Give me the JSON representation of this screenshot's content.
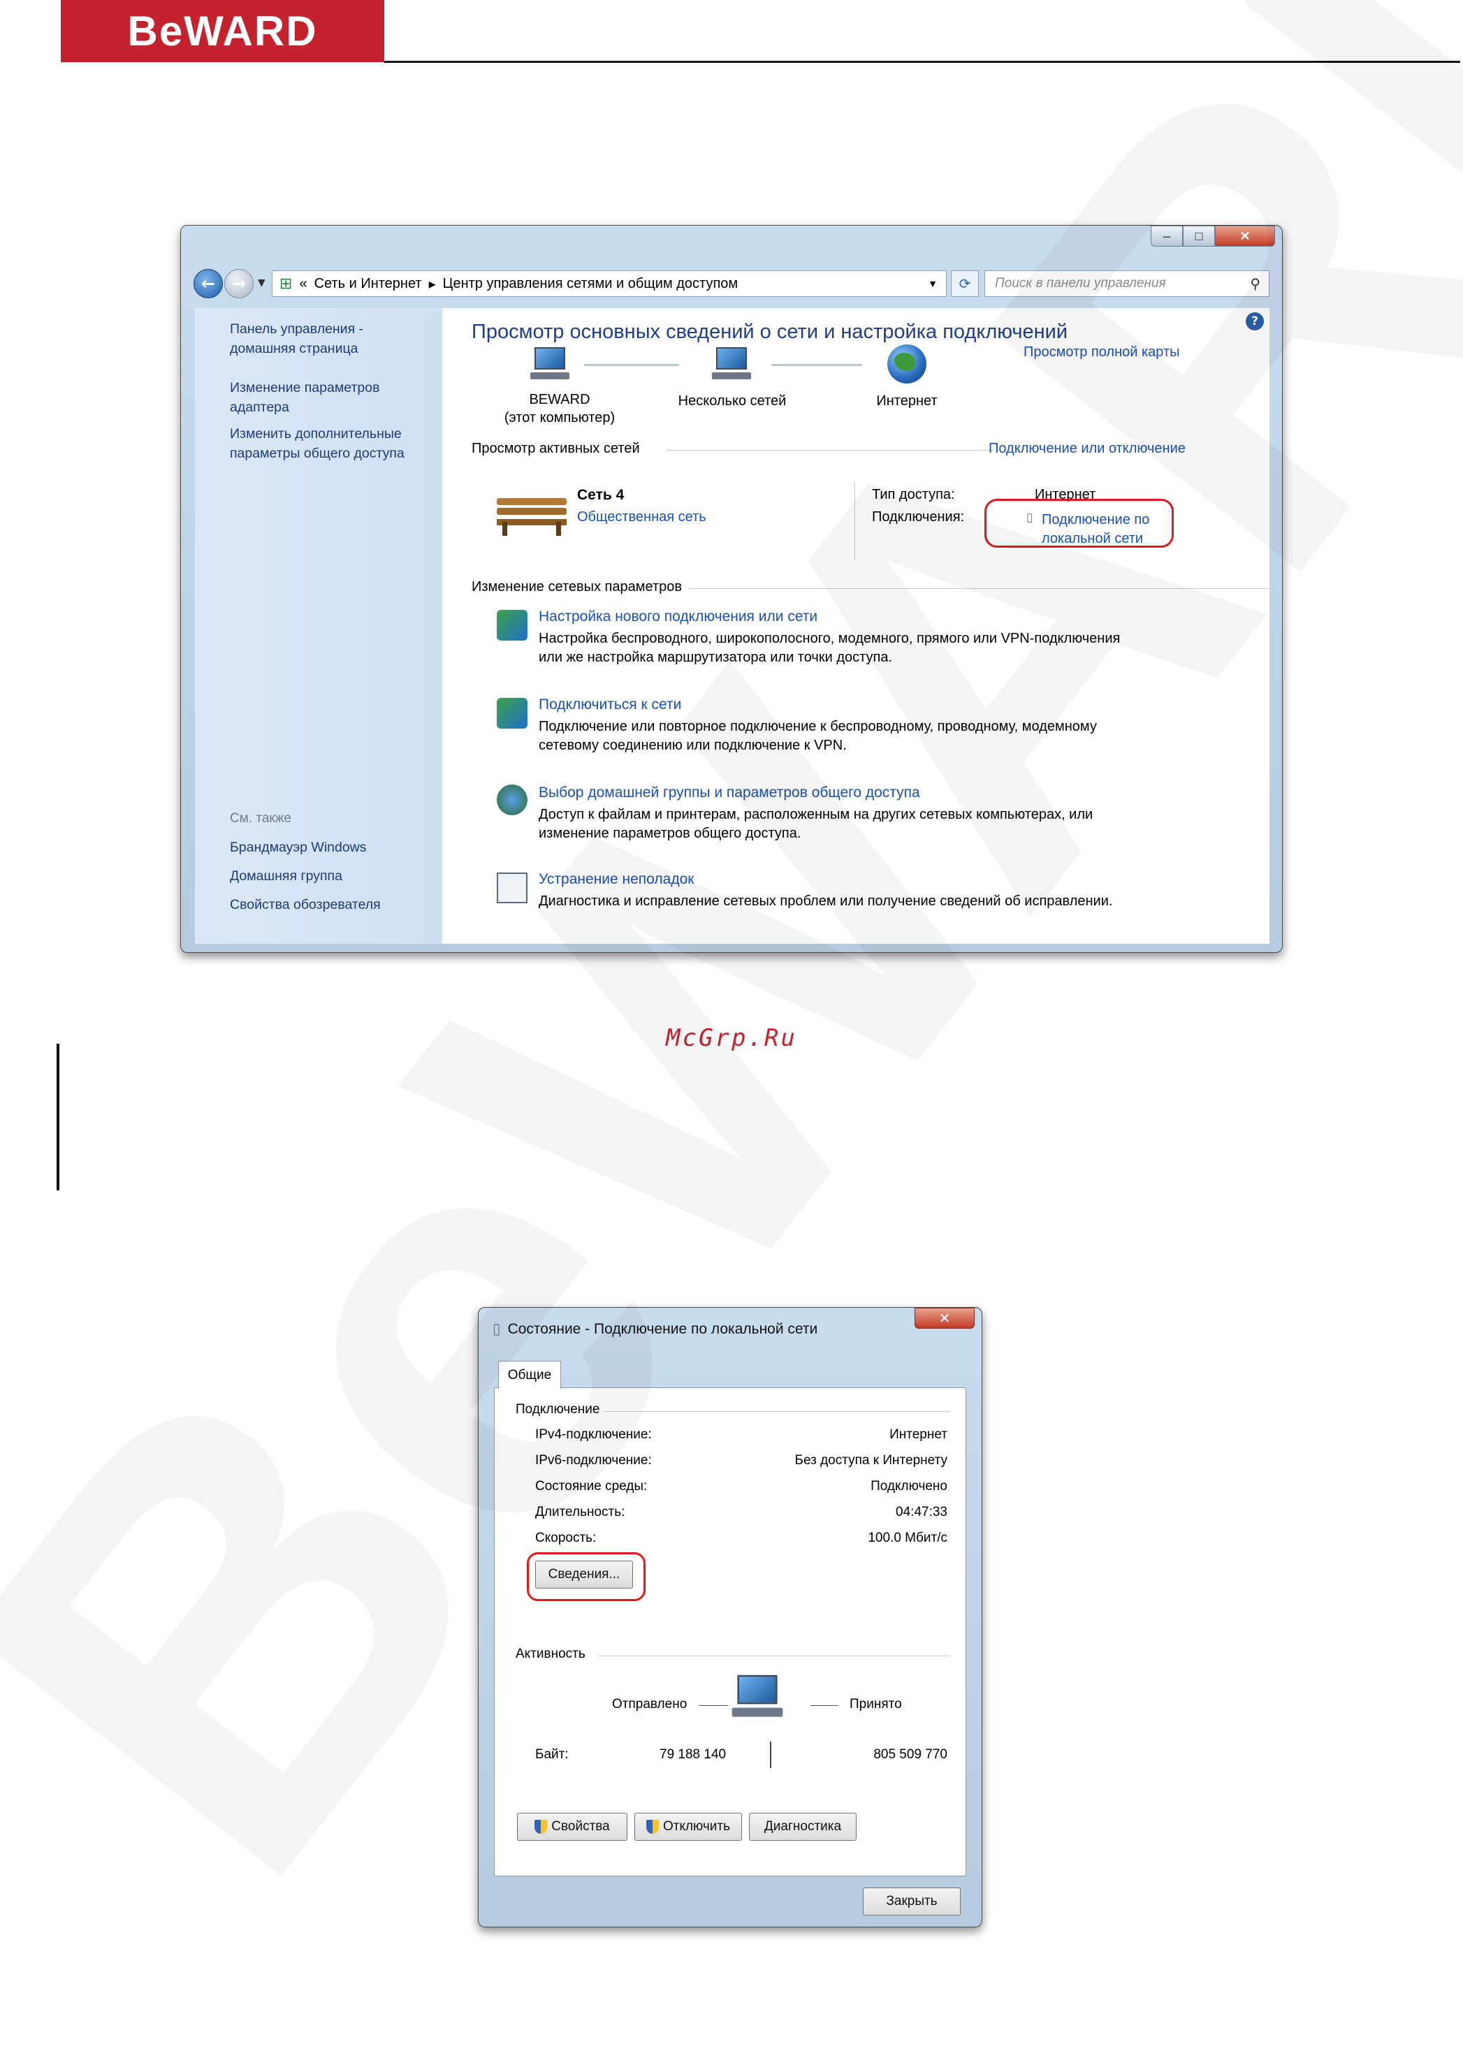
{
  "page": {
    "brand": "BeWARD",
    "caption": "McGrp.Ru"
  },
  "window1": {
    "address": {
      "root_sep": "«",
      "crumb1": "Сеть и Интернет",
      "sep": "▸",
      "crumb2": "Центр управления сетями и общим доступом"
    },
    "search_placeholder": "Поиск в панели управления",
    "sidebar": {
      "links": [
        "Панель управления -",
        "домашняя страница",
        "Изменение параметров",
        "адаптера",
        "Изменить дополнительные",
        "параметры общего доступа"
      ],
      "see_also": "См. также",
      "see_also_links": [
        "Брандмауэр Windows",
        "Домашняя группа",
        "Свойства обозревателя"
      ]
    },
    "main": {
      "title": "Просмотр основных сведений о сети и настройка подключений",
      "full_map": "Просмотр полной карты",
      "nodes": [
        {
          "label": "BEWARD",
          "sublabel": "(этот компьютер)"
        },
        {
          "label": "Несколько сетей"
        },
        {
          "label": "Интернет"
        }
      ],
      "active_header": "Просмотр активных сетей",
      "connect_disconnect": "Подключение или отключение",
      "network_name": "Сеть  4",
      "network_type": "Общественная сеть",
      "access_type_label": "Тип доступа:",
      "access_type_value": "Интернет",
      "connections_label": "Подключения:",
      "connection_value_1": "Подключение по",
      "connection_value_2": "локальной сети",
      "change_header": "Изменение сетевых параметров",
      "tasks": [
        {
          "title": "Настройка нового подключения или сети",
          "desc1": "Настройка беспроводного, широкополосного, модемного, прямого или VPN-подключения",
          "desc2": "или же настройка маршрутизатора или точки доступа."
        },
        {
          "title": "Подключиться к сети",
          "desc1": "Подключение или повторное подключение к беспроводному, проводному, модемному",
          "desc2": "сетевому соединению или подключение к VPN."
        },
        {
          "title": "Выбор домашней группы и параметров общего доступа",
          "desc1": "Доступ к файлам и принтерам, расположенным на других сетевых компьютерах, или",
          "desc2": "изменение параметров общего доступа."
        },
        {
          "title": "Устранение неполадок",
          "desc1": "Диагностика и исправление сетевых проблем или получение сведений об исправлении.",
          "desc2": ""
        }
      ]
    }
  },
  "window2": {
    "title": "Состояние - Подключение по локальной сети",
    "tab": "Общие",
    "connection_header": "Подключение",
    "rows": [
      {
        "label": "IPv4-подключение:",
        "value": "Интернет"
      },
      {
        "label": "IPv6-подключение:",
        "value": "Без доступа к Интернету"
      },
      {
        "label": "Состояние среды:",
        "value": "Подключено"
      },
      {
        "label": "Длительность:",
        "value": "04:47:33"
      },
      {
        "label": "Скорость:",
        "value": "100.0 Мбит/с"
      }
    ],
    "details_button": "Сведения...",
    "activity_header": "Активность",
    "sent_label": "Отправлено",
    "received_label": "Принято",
    "bytes_label": "Байт:",
    "bytes_sent": "79 188 140",
    "bytes_received": "805 509 770",
    "buttons": {
      "properties": "Свойства",
      "disable": "Отключить",
      "diagnose": "Диагностика",
      "close": "Закрыть"
    }
  }
}
